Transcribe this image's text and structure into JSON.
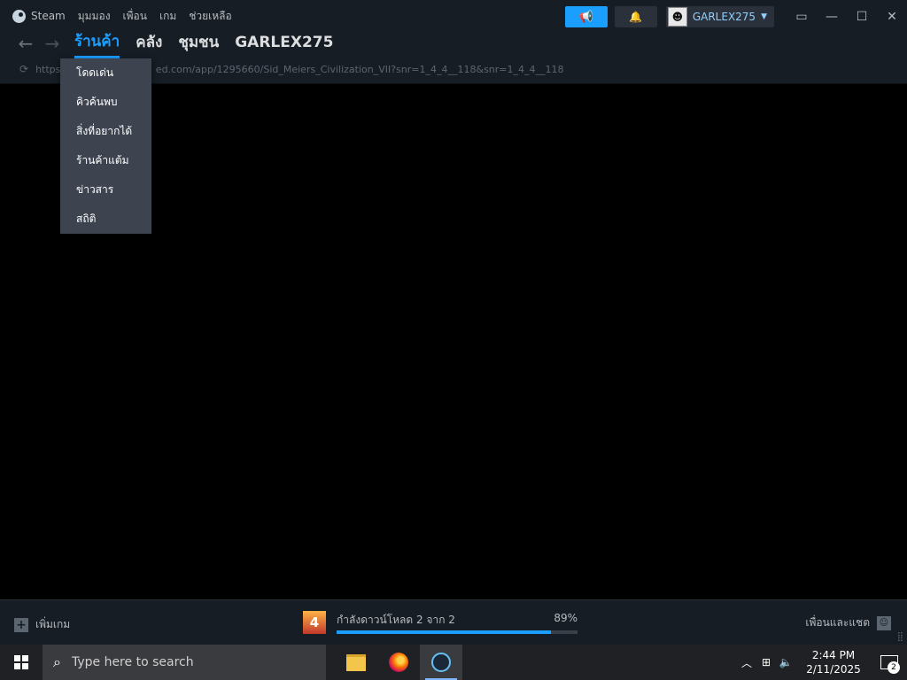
{
  "menu": {
    "app": "Steam",
    "items": [
      "มุมมอง",
      "เพื่อน",
      "เกม",
      "ช่วยเหลือ"
    ]
  },
  "titlebar": {
    "username": "GARLEX275",
    "announce_icon": "megaphone-icon",
    "bell_icon": "bell-icon",
    "window_controls": [
      "monitor-icon",
      "minimize-icon",
      "maximize-icon",
      "close-icon"
    ]
  },
  "nav": {
    "back": "←",
    "forward": "→",
    "tabs": [
      "ร้านค้า",
      "คลัง",
      "ชุมชน",
      "GARLEX275"
    ],
    "active_tab": "ร้านค้า"
  },
  "url": {
    "prefix": "https:/",
    "rest": "ed.com/app/1295660/Sid_Meiers_Civilization_VII?snr=1_4_4__118&snr=1_4_4__118"
  },
  "dropdown": {
    "items": [
      "โดดเด่น",
      "คิวค้นพบ",
      "สิ่งที่อยากได้",
      "ร้านค้าแต้ม",
      "ข่าวสาร",
      "สถิติ"
    ]
  },
  "bottombar": {
    "add_game": "เพิ่มเกม",
    "download_status": "กำลังดาวน์โหลด 2 จาก 2",
    "download_percent": "89%",
    "download_progress": 0.89,
    "friends_chat": "เพื่อนและแชต",
    "game_icon_label": "4"
  },
  "taskbar": {
    "search_placeholder": "Type here to search",
    "apps": [
      "file-explorer-icon",
      "firefox-icon",
      "steam-icon"
    ],
    "time": "2:44 PM",
    "date": "2/11/2025",
    "notifications": "2"
  },
  "colors": {
    "accent": "#1a9fff",
    "titlebar": "#171d25",
    "dropdown": "#3d4450",
    "taskbar": "#202124"
  }
}
